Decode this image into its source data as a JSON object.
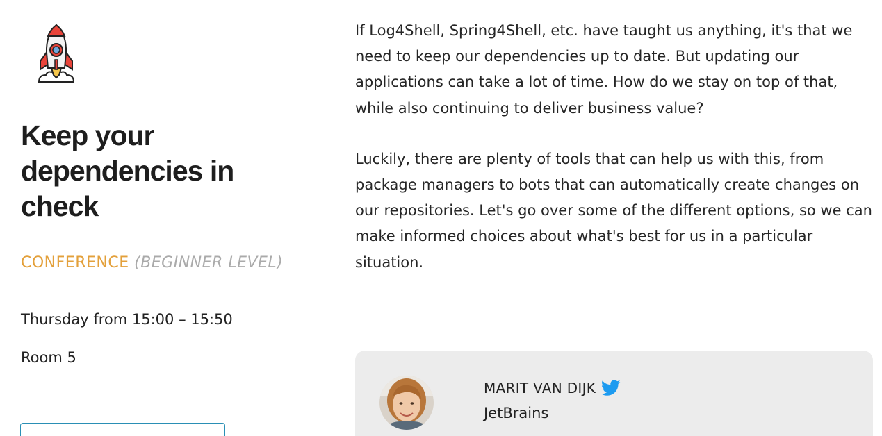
{
  "session": {
    "title": "Keep your dependencies in check",
    "track_type": "CONFERENCE",
    "track_level": "(BEGINNER LEVEL)",
    "schedule": "Thursday from 15:00 – 15:50",
    "room": "Room 5",
    "icon": "rocket-icon"
  },
  "abstract": {
    "paragraphs": [
      "If Log4Shell, Spring4Shell, etc. have taught us anything, it's that we need to keep our dependencies up to date. But updating our applications can take a lot of time. How do we stay on top of that, while also continuing to deliver business value?",
      "Luckily, there are plenty of tools that can help us with this, from package managers to bots that can automatically create changes on our repositories. Let's go over some of the different options, so we can make informed choices about what's best for us in a particular situation."
    ]
  },
  "speaker": {
    "name": "MARIT VAN DIJK",
    "company": "JetBrains",
    "social_icon": "twitter-icon"
  },
  "colors": {
    "track_type": "#e3a03b",
    "track_level": "#aaaaaa",
    "card_background": "#ececec",
    "twitter": "#1d9bf0",
    "button_border": "#2a8fb5"
  }
}
